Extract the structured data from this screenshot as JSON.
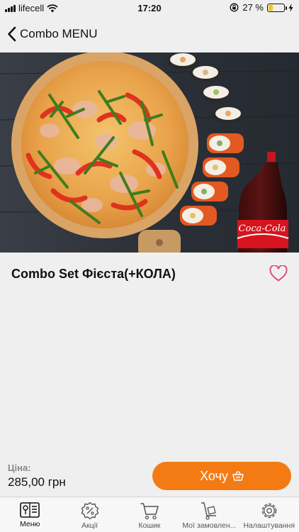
{
  "status_bar": {
    "carrier": "lifecell",
    "time": "17:20",
    "battery_percent": "27 %",
    "battery_level": 0.27
  },
  "nav": {
    "back_label": "Combo MENU"
  },
  "hero": {
    "icon": "product-photo-pizza-sushi-cola",
    "bottle_text": "Coca-Cola"
  },
  "product": {
    "title": "Combo Set Фієста(+КОЛА)",
    "favorite_icon": "heart-outline-icon"
  },
  "price": {
    "label": "Ціна:",
    "value": "285,00 грн"
  },
  "order_button": {
    "label": "Хочу",
    "icon": "basket-icon"
  },
  "colors": {
    "accent": "#f47b14",
    "favorite": "#d9446c",
    "background": "#efefef"
  },
  "tabs": [
    {
      "label": "Меню",
      "icon": "menu-book-icon",
      "active": true
    },
    {
      "label": "Акції",
      "icon": "discount-badge-icon",
      "active": false
    },
    {
      "label": "Кошик",
      "icon": "cart-icon",
      "active": false
    },
    {
      "label": "Мої замовлен...",
      "icon": "hand-truck-icon",
      "active": false
    },
    {
      "label": "Налаштування",
      "icon": "gear-icon",
      "active": false
    }
  ]
}
